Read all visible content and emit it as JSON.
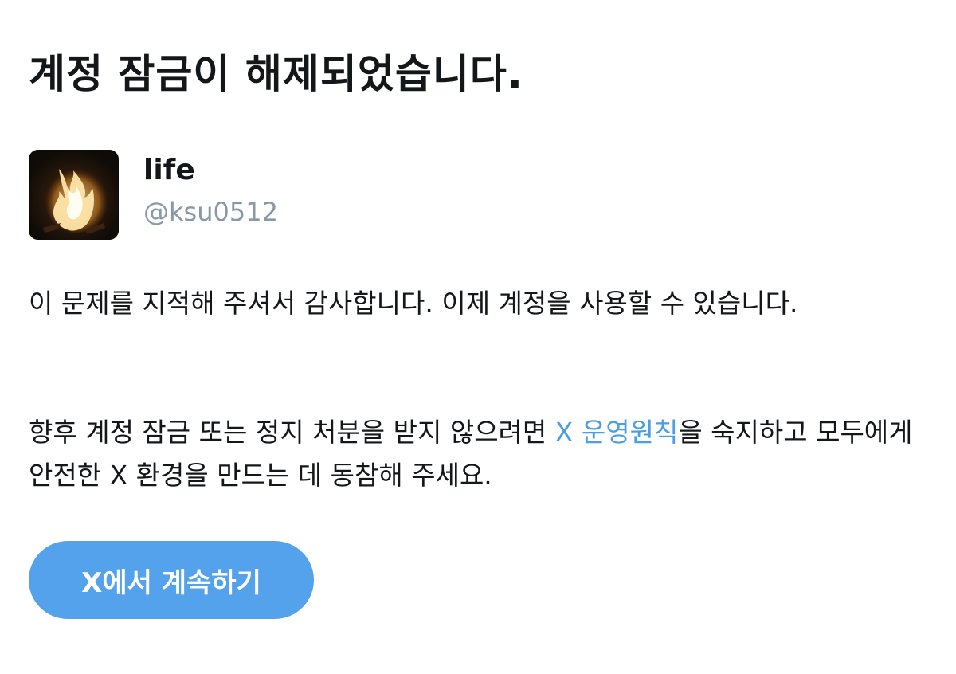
{
  "title": "계정 잠금이 해제되었습니다.",
  "profile": {
    "name": "life",
    "handle": "@ksu0512",
    "avatar": "avatar-image-fire"
  },
  "message": {
    "paragraph1": "이 문제를 지적해 주셔서 감사합니다. 이제 계정을 사용할 수 있습니다.",
    "paragraph2_before": "향후 계정 잠금 또는 정지 처분을 받지 않으려면 ",
    "paragraph2_link": "X 운영원칙",
    "paragraph2_after": "을 숙지하고 모두에게 안전한 X 환경을 만드는 데 동참해 주세요."
  },
  "button": {
    "label": "X에서 계속하기"
  },
  "colors": {
    "text": "#14171a",
    "secondary_text": "#8899a6",
    "link": "#4a9ee8",
    "button_background": "#55a2ec",
    "button_text": "#ffffff"
  }
}
